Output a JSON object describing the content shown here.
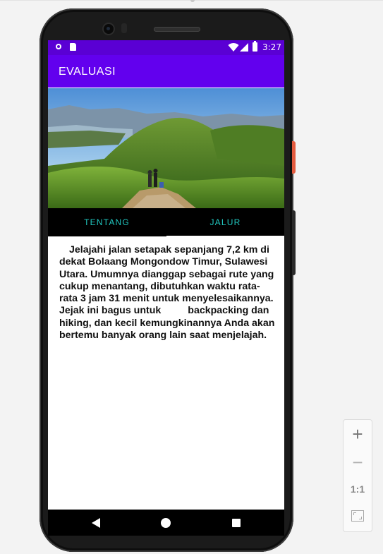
{
  "statusbar": {
    "time": "3:27",
    "icons": [
      "notification-dot-icon",
      "sd-card-icon",
      "wifi-icon",
      "signal-icon",
      "battery-icon"
    ]
  },
  "appbar": {
    "title": "EVALUASI",
    "color": "#6200ee"
  },
  "hero": {
    "image": "mountain-landscape-with-hikers"
  },
  "tabs": [
    {
      "label": "TENTANG",
      "selected": false
    },
    {
      "label": "JALUR",
      "selected": true
    }
  ],
  "content": {
    "part1": "Jelajahi jalan setapak sepanjang 7,2 km di dekat Bolaang Mongondow Timur, Sulawesi Utara. Umumnya dianggap sebagai rute yang cukup menantang, dibutuhkan waktu rata-rata 3 jam 31 menit untuk menyelesaikannya. Jejak ini bagus untuk",
    "part2": "backpacking dan hiking, dan kecil kemungkinannya Anda akan bertemu banyak orang lain saat menjelajah."
  },
  "navbar": {
    "icons": [
      "back-icon",
      "home-icon",
      "recents-icon"
    ]
  },
  "zoom_controls": {
    "plus": "+",
    "minus": "−",
    "one_to_one": "1:1"
  },
  "colors": {
    "statusbar": "#5a00d4",
    "tab_text": "#21c7c0",
    "tab_indicator": "#ffffff"
  }
}
